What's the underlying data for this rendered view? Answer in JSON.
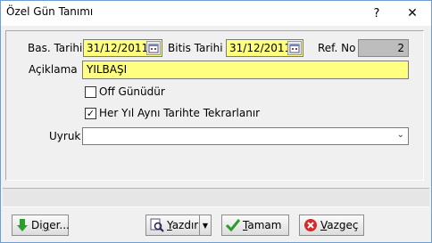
{
  "window": {
    "title": "Özel Gün Tanımı",
    "help_label": "?",
    "close_label": "✕"
  },
  "form": {
    "start_date_label": "Bas. Tarihi",
    "start_date_value": "31/12/2011",
    "end_date_label": "Bitis Tarihi",
    "end_date_value": "31/12/2011",
    "ref_label": "Ref. No",
    "ref_value": "2",
    "description_label": "Açiklama",
    "description_value": "YILBAŞI",
    "off_day_label": "Off Günüdür",
    "off_day_checked": false,
    "repeat_label": "Her Yıl Aynı Tarihte Tekrarlanır",
    "repeat_checked": true,
    "nationality_label": "Uyruk",
    "nationality_value": ""
  },
  "buttons": {
    "other_prefix": "Di",
    "other_key": "g",
    "other_suffix": "er...",
    "print_prefix": "",
    "print_key": "Y",
    "print_suffix": "azdır",
    "ok_prefix": "",
    "ok_key": "T",
    "ok_suffix": "amam",
    "cancel_prefix": "",
    "cancel_key": "V",
    "cancel_suffix": "azgeç"
  },
  "colors": {
    "required_field": "#ffff80",
    "readonly_field": "#bdbdbd",
    "window_border": "#6f9fd0"
  }
}
